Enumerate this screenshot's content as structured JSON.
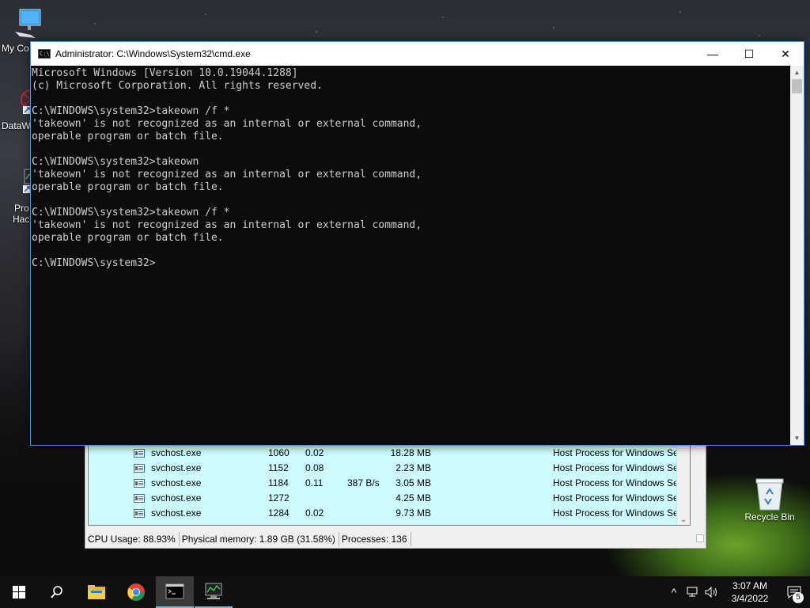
{
  "desktop": {
    "icons": [
      {
        "label": "My Co"
      },
      {
        "label": "DataW"
      },
      {
        "label": "Pro"
      },
      {
        "label": "Hac"
      },
      {
        "label": "Recycle Bin"
      }
    ]
  },
  "cmd": {
    "title": "Administrator: C:\\Windows\\System32\\cmd.exe",
    "app_icon_text": "C:\\_",
    "lines": [
      "Microsoft Windows [Version 10.0.19044.1288]",
      "(c) Microsoft Corporation. All rights reserved.",
      "",
      "C:\\WINDOWS\\system32>takeown /f *",
      "'takeown' is not recognized as an internal or external command,",
      "operable program or batch file.",
      "",
      "C:\\WINDOWS\\system32>takeown",
      "'takeown' is not recognized as an internal or external command,",
      "operable program or batch file.",
      "",
      "C:\\WINDOWS\\system32>takeown /f *",
      "'takeown' is not recognized as an internal or external command,",
      "operable program or batch file.",
      "",
      "C:\\WINDOWS\\system32>"
    ],
    "minimize_glyph": "—",
    "maximize_glyph": "☐",
    "close_glyph": "✕"
  },
  "taskmgr": {
    "rows": [
      {
        "name": "svchost.exe",
        "pid": "1060",
        "cpu": "0.02",
        "io": "",
        "mem": "18.28 MB",
        "desc": "Host Process for Windows Ser..."
      },
      {
        "name": "svchost.exe",
        "pid": "1152",
        "cpu": "0.08",
        "io": "",
        "mem": "2.23 MB",
        "desc": "Host Process for Windows Ser..."
      },
      {
        "name": "svchost.exe",
        "pid": "1184",
        "cpu": "0.11",
        "io": "387 B/s",
        "mem": "3.05 MB",
        "desc": "Host Process for Windows Ser..."
      },
      {
        "name": "svchost.exe",
        "pid": "1272",
        "cpu": "",
        "io": "",
        "mem": "4.25 MB",
        "desc": "Host Process for Windows Ser..."
      },
      {
        "name": "svchost.exe",
        "pid": "1284",
        "cpu": "0.02",
        "io": "",
        "mem": "9.73 MB",
        "desc": "Host Process for Windows Ser..."
      }
    ],
    "status": {
      "cpu": "CPU Usage: 88.93%",
      "memory": "Physical memory: 1.89 GB (31.58%)",
      "processes": "Processes: 136"
    }
  },
  "taskbar": {
    "start_icon": "windows-logo",
    "search_icon": "search",
    "apps": [
      "file-explorer",
      "chrome",
      "cmd",
      "process-hacker"
    ],
    "tray": {
      "chevron": "^",
      "time": "3:07 AM",
      "date": "3/4/2022",
      "notification_count": "5"
    }
  }
}
